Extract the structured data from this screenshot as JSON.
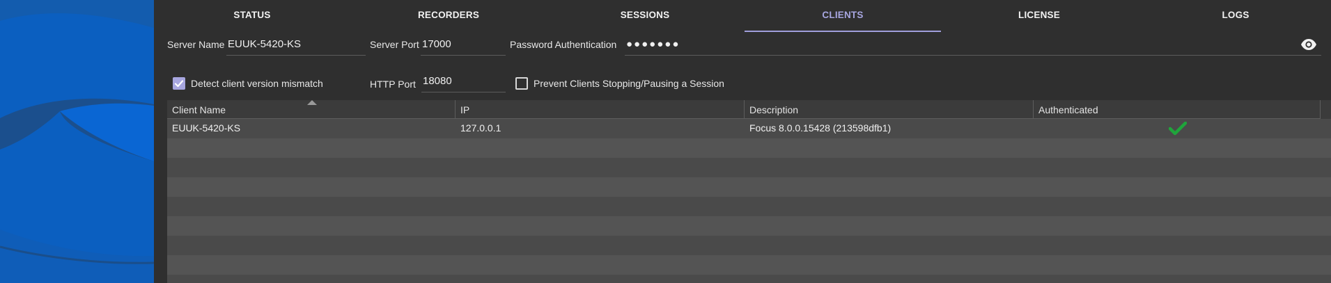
{
  "tabs": [
    {
      "label": "STATUS"
    },
    {
      "label": "RECORDERS"
    },
    {
      "label": "SESSIONS"
    },
    {
      "label": "CLIENTS",
      "active": true
    },
    {
      "label": "LICENSE"
    },
    {
      "label": "LOGS"
    }
  ],
  "form": {
    "server_name_label": "Server Name",
    "server_name_value": "EUUK-5420-KS",
    "server_port_label": "Server Port",
    "server_port_value": "17000",
    "password_label": "Password Authentication",
    "password_value": "●●●●●●●",
    "detect_mismatch_label": "Detect client version mismatch",
    "detect_mismatch_checked": true,
    "http_port_label": "HTTP Port",
    "http_port_value": "18080",
    "prevent_stopping_label": "Prevent Clients Stopping/Pausing a Session",
    "prevent_stopping_checked": false
  },
  "table": {
    "columns": [
      "Client Name",
      "IP",
      "Description",
      "Authenticated"
    ],
    "rows": [
      {
        "client_name": "EUUK-5420-KS",
        "ip": "127.0.0.1",
        "description": "Focus 8.0.0.15428 (213598dfb1)",
        "authenticated": true
      }
    ]
  },
  "colors": {
    "accent": "#a7a6e0",
    "check": "#1fa53b",
    "brand_blue": "#0a64c8"
  },
  "icons": {
    "eye": "eye-icon",
    "check": "checkmark-icon",
    "sort": "sort-ascending-icon"
  }
}
